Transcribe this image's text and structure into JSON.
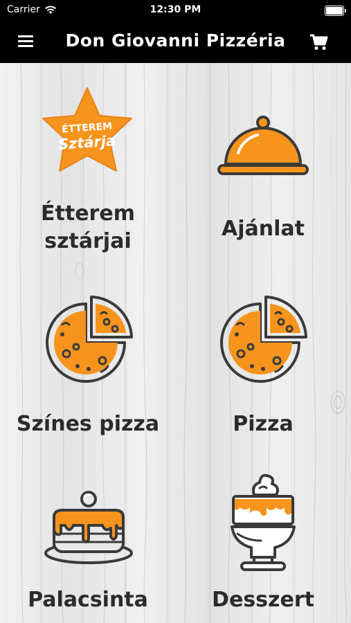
{
  "status": {
    "carrier": "Carrier",
    "time": "12:30 PM"
  },
  "navbar": {
    "title": "Don Giovanni Pizzéria"
  },
  "tiles": [
    {
      "label_line1": "Étterem",
      "label_line2": "sztárjai",
      "badge_line1": "ÉTTEREM",
      "badge_line2": "Sztárja"
    },
    {
      "label": "Ajánlat"
    },
    {
      "label": "Színes pizza"
    },
    {
      "label": "Pizza"
    },
    {
      "label": "Palacsinta"
    },
    {
      "label": "Desszert"
    }
  ],
  "colors": {
    "accent": "#f7941d",
    "dark": "#3a3a3a",
    "bar": "#000000"
  }
}
